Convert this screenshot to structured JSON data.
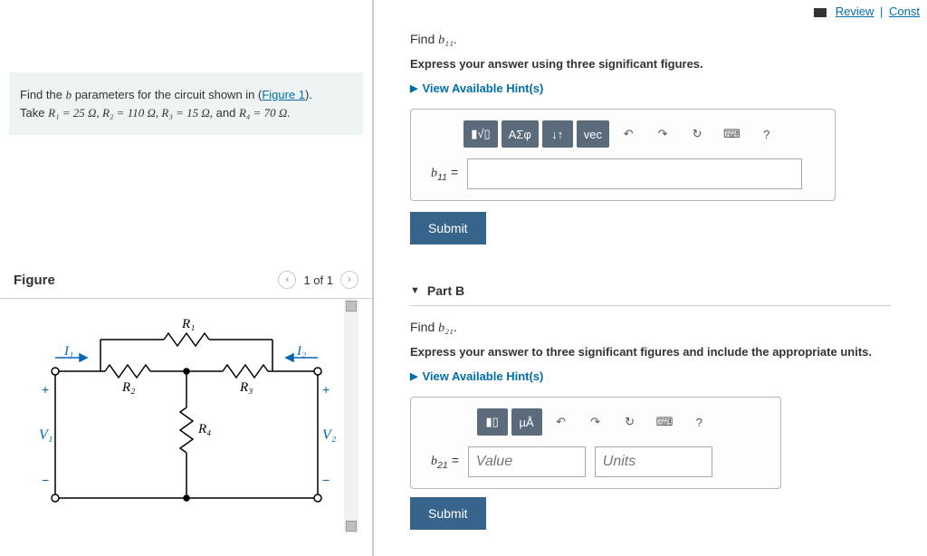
{
  "top_links": {
    "review": "Review",
    "const": "Const"
  },
  "problem": {
    "text_pre": "Find the ",
    "var_b": "b",
    "text_mid": " parameters for the circuit shown in (",
    "figure_link": "Figure 1",
    "text_post": ").",
    "take": "Take ",
    "r1": "R₁ = 25 Ω, R₂ = 110 Ω, R₃ = 15 Ω,",
    "and": " and ",
    "r4": "R₄ = 70 Ω."
  },
  "figure": {
    "title": "Figure",
    "nav_label": "1 of 1"
  },
  "circuit": {
    "r1": "R₁",
    "r2": "R₂",
    "r3": "R₃",
    "r4": "R₄",
    "i1": "I₁",
    "i2": "I₂",
    "v1": "V₁",
    "v2": "V₂"
  },
  "partA": {
    "find_pre": "Find ",
    "find_var": "b₁₁",
    "find_post": ".",
    "instruction": "Express your answer using three significant figures.",
    "hints": "View Available Hint(s)",
    "var_label_pre": "b",
    "var_label_sub": "11",
    "var_label_eq": " = ",
    "submit": "Submit",
    "toolbar": {
      "templates": "▮√▯",
      "symbols": "ΑΣφ",
      "subscript": "↓↑",
      "vec": "vec",
      "undo": "↶",
      "redo": "↷",
      "reset": "↻",
      "keyboard": "⌨",
      "help": "?"
    }
  },
  "partB": {
    "title": "Part B",
    "find_pre": "Find ",
    "find_var": "b₂₁",
    "find_post": ".",
    "instruction": "Express your answer to three significant figures and include the appropriate units.",
    "hints": "View Available Hint(s)",
    "var_label_pre": "b",
    "var_label_sub": "21",
    "var_label_eq": " = ",
    "value_placeholder": "Value",
    "units_placeholder": "Units",
    "submit": "Submit",
    "toolbar": {
      "templates": "▮▯",
      "units": "µÅ",
      "undo": "↶",
      "redo": "↷",
      "reset": "↻",
      "keyboard": "⌨",
      "help": "?"
    }
  }
}
